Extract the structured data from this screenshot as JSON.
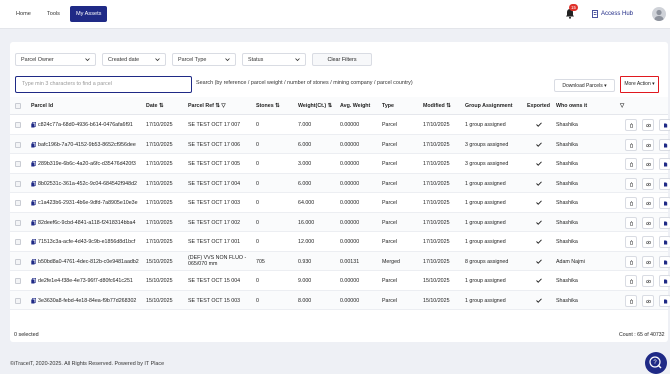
{
  "nav": {
    "home": "Home",
    "tools": "Tools",
    "my_assets": "My Assets"
  },
  "header": {
    "notification_count": "15",
    "access_hub": "Access Hub"
  },
  "filters": {
    "owner": "Parcel Owner",
    "created": "Created date",
    "type": "Parcel Type",
    "status": "Status",
    "clear": "Clear Filters"
  },
  "search": {
    "placeholder": "Type min 3 characters to find a parcel",
    "help": "Search (by reference / parcel weight / number of stones / mining company / parcel country)"
  },
  "actions": {
    "download": "Download Parcels ▾",
    "more": "More Action ▾"
  },
  "columns": {
    "id": "Parcel Id",
    "date": "Date",
    "ref": "Parcel Ref",
    "stones": "Stones",
    "weight": "Weight(Ct.)",
    "avg": "Avg. Weight",
    "type": "Type",
    "modified": "Modified",
    "group": "Group Assignment",
    "exported": "Exported",
    "owner": "Who owns it"
  },
  "rows": [
    {
      "id": "c824c77a-68d0-4936-b614-0476afa6f91",
      "date": "17/10/2025",
      "ref": "SE TEST OCT 17 007",
      "ref2": "",
      "stones": "0",
      "weight": "7.000",
      "avg": "0.00000",
      "type": "Parcel",
      "modified": "17/10/2025",
      "group": "1 group assigned",
      "owner": "Shashika"
    },
    {
      "id": "bafc196b-7a70-4152-9b53-8652cf956dee",
      "date": "17/10/2025",
      "ref": "SE TEST OCT 17 006",
      "ref2": "",
      "stones": "0",
      "weight": "6.000",
      "avg": "0.00000",
      "type": "Parcel",
      "modified": "17/10/2025",
      "group": "3 groups assigned",
      "owner": "Shashika"
    },
    {
      "id": "289b319e-6b6c-4a20-a6fc-d35476d420f3",
      "date": "17/10/2025",
      "ref": "SE TEST OCT 17 005",
      "ref2": "",
      "stones": "0",
      "weight": "3.000",
      "avg": "0.00000",
      "type": "Parcel",
      "modified": "17/10/2025",
      "group": "3 groups assigned",
      "owner": "Shashika"
    },
    {
      "id": "8b02531c-361a-452c-9c04-684542f948d2",
      "date": "17/10/2025",
      "ref": "SE TEST OCT 17 004",
      "ref2": "",
      "stones": "0",
      "weight": "6.000",
      "avg": "0.00000",
      "type": "Parcel",
      "modified": "17/10/2025",
      "group": "1 group assigned",
      "owner": "Shashika"
    },
    {
      "id": "c1a423b6-2931-4b6e-9dfd-7a8905e10e3e",
      "date": "17/10/2025",
      "ref": "SE TEST OCT 17 003",
      "ref2": "",
      "stones": "0",
      "weight": "64.000",
      "avg": "0.00000",
      "type": "Parcel",
      "modified": "17/10/2025",
      "group": "1 group assigned",
      "owner": "Shashika"
    },
    {
      "id": "82deef6c-9cbd-4841-a118-f2418314bba4",
      "date": "17/10/2025",
      "ref": "SE TEST OCT 17 002",
      "ref2": "",
      "stones": "0",
      "weight": "16.000",
      "avg": "0.00000",
      "type": "Parcel",
      "modified": "17/10/2025",
      "group": "1 group assigned",
      "owner": "Shashika"
    },
    {
      "id": "71513c3a-acfe-4d43-9c9b-e1856d8d1bcf",
      "date": "17/10/2025",
      "ref": "SE TEST OCT 17 001",
      "ref2": "",
      "stones": "0",
      "weight": "12.000",
      "avg": "0.00000",
      "type": "Parcel",
      "modified": "17/10/2025",
      "group": "1 group assigned",
      "owner": "Shashika"
    },
    {
      "id": "b50bd8a0-4761-4dec-812b-c0e9481aadb2",
      "date": "15/10/2025",
      "ref": "(DEF) VVS NON FLUO -",
      "ref2": "065/070 mm",
      "stones": "705",
      "weight": "0.930",
      "avg": "0.00131",
      "type": "Merged",
      "modified": "17/10/2025",
      "group": "8 groups assigned",
      "owner": "Adam Najmi"
    },
    {
      "id": "de2fe1e4-f38e-4e73-96f7-d80fc641c251",
      "date": "15/10/2025",
      "ref": "SE TEST OCT 15 004",
      "ref2": "",
      "stones": "0",
      "weight": "9.000",
      "avg": "0.00000",
      "type": "Parcel",
      "modified": "15/10/2025",
      "group": "1 group assigned",
      "owner": "Shashika"
    },
    {
      "id": "3e3630a8-febd-4e18-84ea-f9b77d268302",
      "date": "15/10/2025",
      "ref": "SE TEST OCT 15 003",
      "ref2": "",
      "stones": "0",
      "weight": "8.000",
      "avg": "0.00000",
      "type": "Parcel",
      "modified": "15/10/2025",
      "group": "1 group assigned",
      "owner": "Shashika"
    }
  ],
  "footer": {
    "selected": "0 selected",
    "count": "Count : 65 of 40732",
    "copyright": "©iTraceiT, 2020-2025. All Rights Reserved. Powered by IT Place"
  },
  "colors": {
    "primary": "#1f2a86",
    "alert": "#e0181f"
  }
}
